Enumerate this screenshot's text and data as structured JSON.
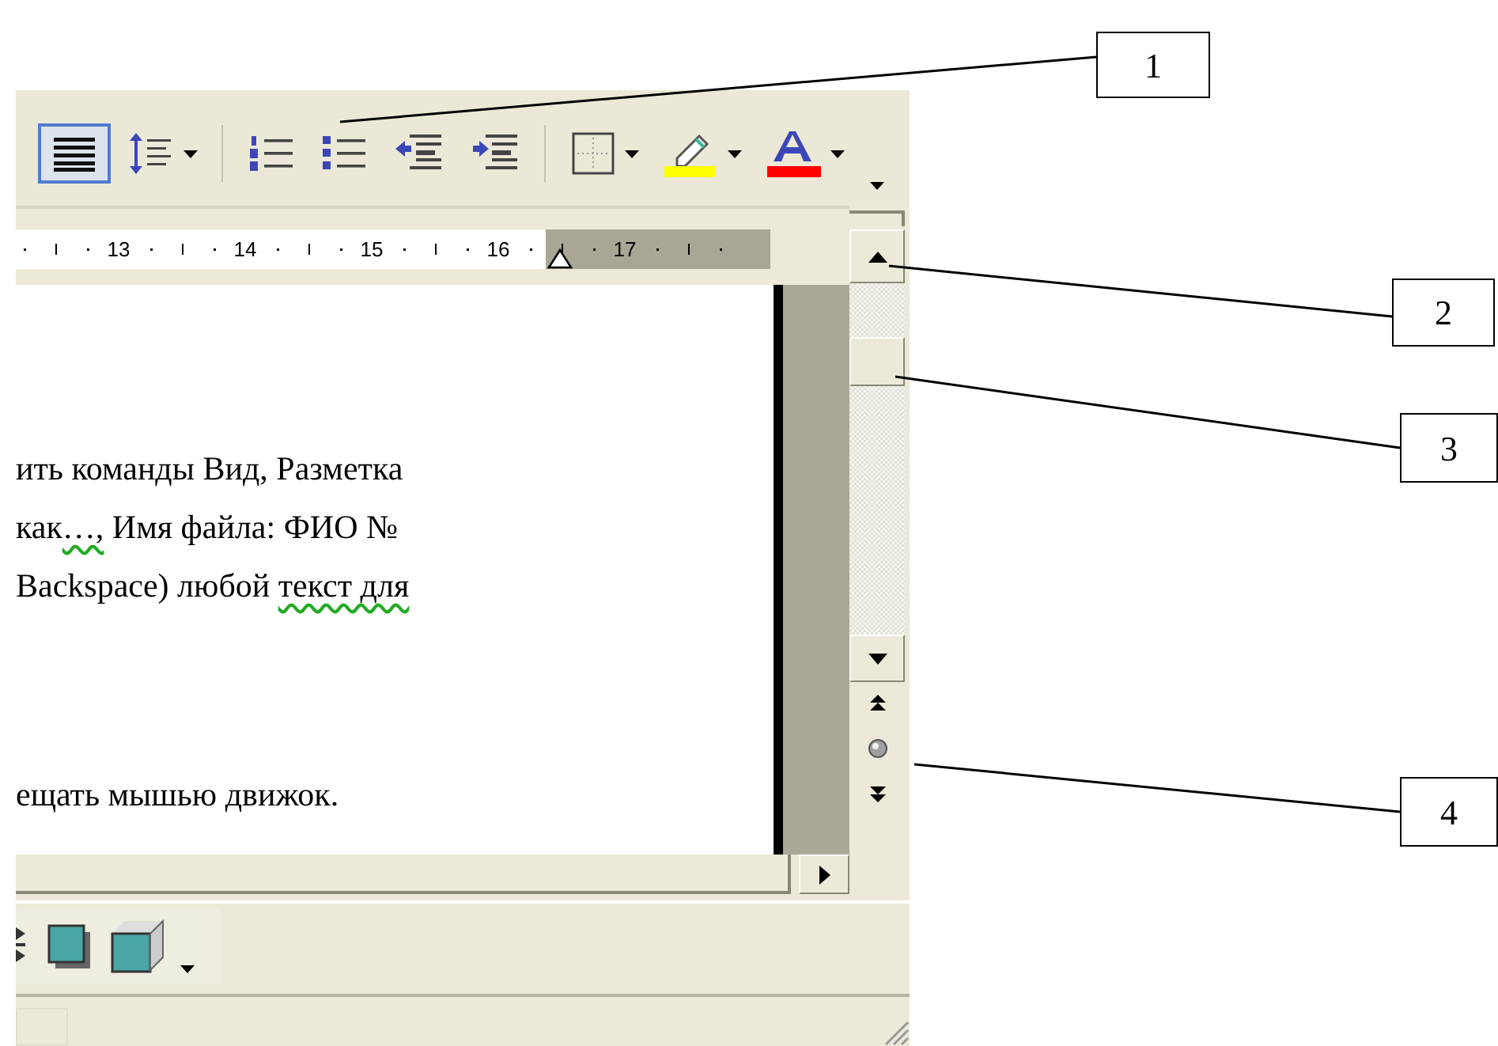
{
  "formatting_toolbar": {
    "buttons": [
      {
        "kind": "justify",
        "selected": true,
        "dropdown": false
      },
      {
        "kind": "line-spacing",
        "selected": false,
        "dropdown": true
      },
      {
        "kind": "separator"
      },
      {
        "kind": "numbering",
        "selected": false,
        "dropdown": false
      },
      {
        "kind": "bullets",
        "selected": false,
        "dropdown": false
      },
      {
        "kind": "decrease-indent",
        "selected": false,
        "dropdown": false
      },
      {
        "kind": "increase-indent",
        "selected": false,
        "dropdown": false
      },
      {
        "kind": "separator"
      },
      {
        "kind": "borders",
        "selected": false,
        "dropdown": true
      },
      {
        "kind": "highlight",
        "selected": false,
        "dropdown": true,
        "color": "#ffff00"
      },
      {
        "kind": "font-color",
        "selected": false,
        "dropdown": true,
        "color": "#ff0000"
      },
      {
        "kind": "options"
      }
    ]
  },
  "ruler": {
    "numbers": [
      "13",
      "14",
      "15",
      "16",
      "17"
    ]
  },
  "document": {
    "paragraphs": [
      {
        "lines": [
          [
            {
              "text": "ить команды Вид, Разметка",
              "flagged": false
            }
          ],
          [
            {
              "text": "как",
              "flagged": false
            },
            {
              "text": "…,",
              "flagged": true
            },
            {
              "text": " Имя файла: ФИО №",
              "flagged": false
            }
          ],
          [
            {
              "text": "Backspace) любой ",
              "flagged": false
            },
            {
              "text": "текст для",
              "flagged": true
            }
          ]
        ]
      },
      {
        "lines": [
          [
            {
              "text": "ещать мышью движок.",
              "flagged": false
            }
          ]
        ]
      }
    ]
  },
  "drawing_toolbar": {
    "buttons": [
      {
        "kind": "partial"
      },
      {
        "kind": "shadow"
      },
      {
        "kind": "cube",
        "dropdown": true
      }
    ]
  },
  "callouts": [
    {
      "label": "1"
    },
    {
      "label": "2"
    },
    {
      "label": "3"
    },
    {
      "label": "4"
    }
  ]
}
